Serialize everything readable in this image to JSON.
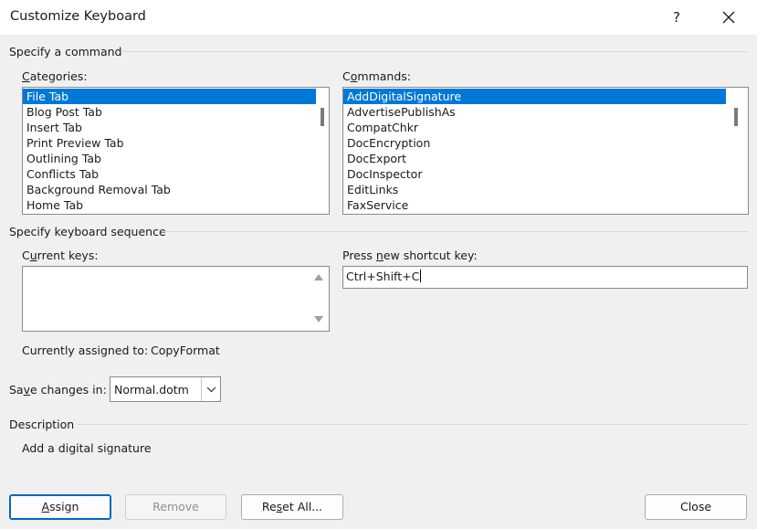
{
  "window": {
    "title": "Customize Keyboard",
    "help_label": "?",
    "close_icon": "close-icon"
  },
  "specify_command": {
    "heading": "Specify a command",
    "categories_label": "Categories:",
    "categories_access_key": "C",
    "categories_label_rest": "ategories:",
    "categories": [
      "File Tab",
      "Blog Post Tab",
      "Insert Tab",
      "Print Preview Tab",
      "Outlining Tab",
      "Conflicts Tab",
      "Background Removal Tab",
      "Home Tab"
    ],
    "categories_selected": "File Tab",
    "commands_label": "Commands:",
    "commands_access_key": "o",
    "commands_label_pre": "C",
    "commands_label_rest": "mmands:",
    "commands": [
      "AddDigitalSignature",
      "AdvertisePublishAs",
      "CompatChkr",
      "DocEncryption",
      "DocExport",
      "DocInspector",
      "EditLinks",
      "FaxService"
    ],
    "commands_selected": "AddDigitalSignature"
  },
  "keyboard_sequence": {
    "heading": "Specify keyboard sequence",
    "current_keys_label": "Current keys:",
    "current_keys_label_pre": "C",
    "current_keys_access_key": "u",
    "current_keys_label_rest": "rrent keys:",
    "new_key_label": "Press new shortcut key:",
    "new_key_label_pre": "Press ",
    "new_key_access_key": "n",
    "new_key_label_rest": "ew shortcut key:",
    "new_key_value": "Ctrl+Shift+C",
    "assigned_label": "Currently assigned to:",
    "assigned_value": "CopyFormat"
  },
  "save_changes": {
    "label": "Save changes in:",
    "label_pre": "Sa",
    "access_key": "v",
    "label_rest": "e changes in:",
    "value": "Normal.dotm"
  },
  "description": {
    "heading": "Description",
    "text": "Add a digital signature"
  },
  "buttons": {
    "assign_pre": "",
    "assign_key": "A",
    "assign_rest": "ssign",
    "remove": "Remove",
    "reset_pre": "Re",
    "reset_key": "s",
    "reset_rest": "et All...",
    "close": "Close"
  },
  "colors": {
    "selection": "#0078d7",
    "primary_border": "#0067c0"
  }
}
